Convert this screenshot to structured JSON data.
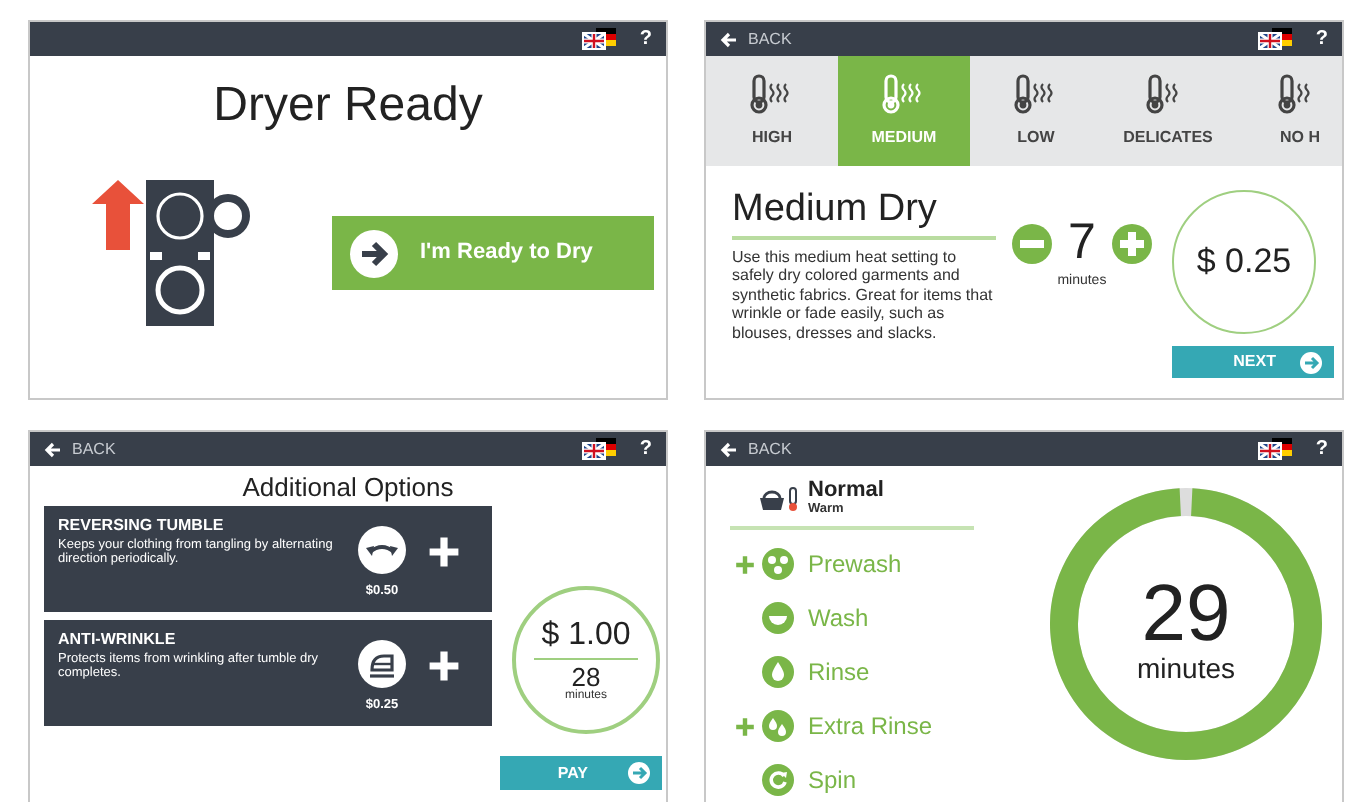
{
  "screens": [
    {
      "kind": "ready",
      "help": "?",
      "title": "Dryer Ready",
      "button": "I'm Ready to Dry"
    },
    {
      "kind": "temperature",
      "back": "BACK",
      "help": "?",
      "tabs": [
        {
          "label": "HIGH",
          "selected": false
        },
        {
          "label": "MEDIUM",
          "selected": true
        },
        {
          "label": "LOW",
          "selected": false
        },
        {
          "label": "DELICATES",
          "selected": false
        },
        {
          "label": "NO H",
          "selected": false
        }
      ],
      "heading": "Medium Dry",
      "description": "Use this medium heat setting to safely dry colored garments and synthetic fabrics. Great for items that wrinkle or fade easily, such as blouses, dresses and slacks.",
      "time": "7",
      "time_unit": "minutes",
      "price": "$ 0.25",
      "next": "NEXT"
    },
    {
      "kind": "options",
      "back": "BACK",
      "help": "?",
      "title": "Additional Options",
      "options": [
        {
          "name": "REVERSING TUMBLE",
          "description": "Keeps your clothing from tangling by alternating direction periodically.",
          "price": "$0.50"
        },
        {
          "name": "ANTI-WRINKLE",
          "description": "Protects items from wrinkling after tumble dry completes.",
          "price": "$0.25"
        }
      ],
      "total": "$ 1.00",
      "time": "28",
      "time_unit": "minutes",
      "pay": "PAY"
    },
    {
      "kind": "progress",
      "back": "BACK",
      "help": "?",
      "program": "Normal",
      "temperature": "Warm",
      "steps": [
        {
          "label": "Prewash",
          "added": true
        },
        {
          "label": "Wash",
          "added": false
        },
        {
          "label": "Rinse",
          "added": false
        },
        {
          "label": "Extra Rinse",
          "added": true
        },
        {
          "label": "Spin",
          "added": false
        }
      ],
      "ring": {
        "level": 0.985
      },
      "time": "29",
      "time_unit": "minutes"
    }
  ]
}
